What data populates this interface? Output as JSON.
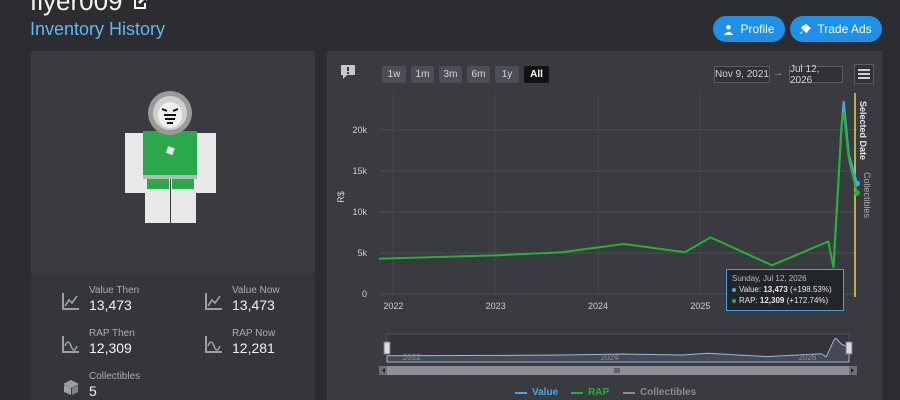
{
  "header": {
    "username": "flyer009",
    "subtitle": "Inventory History",
    "profile_label": "Profile",
    "trade_label": "Trade Ads"
  },
  "stats": {
    "value_then_label": "Value Then",
    "value_then": "13,473",
    "value_now_label": "Value Now",
    "value_now": "13,473",
    "rap_then_label": "RAP Then",
    "rap_then": "12,309",
    "rap_now_label": "RAP Now",
    "rap_now": "12,281",
    "collectibles_label": "Collectibles",
    "collectibles": "5"
  },
  "toolbar": {
    "ranges": [
      "1w",
      "1m",
      "3m",
      "6m",
      "1y",
      "All"
    ],
    "active_range": "All",
    "date_from": "Nov 9, 2021",
    "date_to": "Jul 12, 2026",
    "arrow": "→"
  },
  "colors": {
    "value": "#4aa8e0",
    "rap": "#22b531",
    "collectibles": "#8a8d93",
    "selected": "#e8d44a",
    "accent": "#1e90e8"
  },
  "chart_data": {
    "type": "line",
    "ylabel": "R$",
    "y_ticks": [
      "0",
      "5k",
      "10k",
      "15k",
      "20k"
    ],
    "ylim": [
      0,
      24500
    ],
    "x_ticks": [
      "2022",
      "2023",
      "2024",
      "2025"
    ],
    "x_tick_dates": [
      2022.0,
      2023.0,
      2024.0,
      2025.0
    ],
    "xlim": [
      2021.86,
      2026.53
    ],
    "series": [
      {
        "name": "Value",
        "points": [
          [
            2026.3,
            3200
          ],
          [
            2026.38,
            20500
          ],
          [
            2026.4,
            23500
          ],
          [
            2026.45,
            17000
          ],
          [
            2026.53,
            13473
          ]
        ]
      },
      {
        "name": "RAP",
        "points": [
          [
            2021.86,
            4300
          ],
          [
            2023.0,
            4700
          ],
          [
            2023.65,
            5100
          ],
          [
            2024.25,
            6100
          ],
          [
            2024.85,
            5100
          ],
          [
            2025.1,
            6900
          ],
          [
            2025.7,
            3500
          ],
          [
            2026.25,
            6400
          ],
          [
            2026.3,
            3200
          ],
          [
            2026.38,
            20800
          ],
          [
            2026.4,
            22200
          ],
          [
            2026.45,
            16500
          ],
          [
            2026.53,
            12309
          ]
        ]
      },
      {
        "name": "Collectibles",
        "points": []
      }
    ],
    "selected_label": "Selected Date",
    "collectibles_axis_label": "Collectibles",
    "legend": [
      "Value",
      "RAP",
      "Collectibles"
    ],
    "grid": true
  },
  "navigator": {
    "x_ticks": [
      "2022",
      "2024",
      "2026"
    ]
  },
  "tooltip": {
    "date": "Sunday, Jul 12, 2026",
    "value_label": "Value:",
    "value": "13,473",
    "value_change": "(+198.53%)",
    "rap_label": "RAP:",
    "rap": "12,309",
    "rap_change": "(+172.74%)"
  }
}
